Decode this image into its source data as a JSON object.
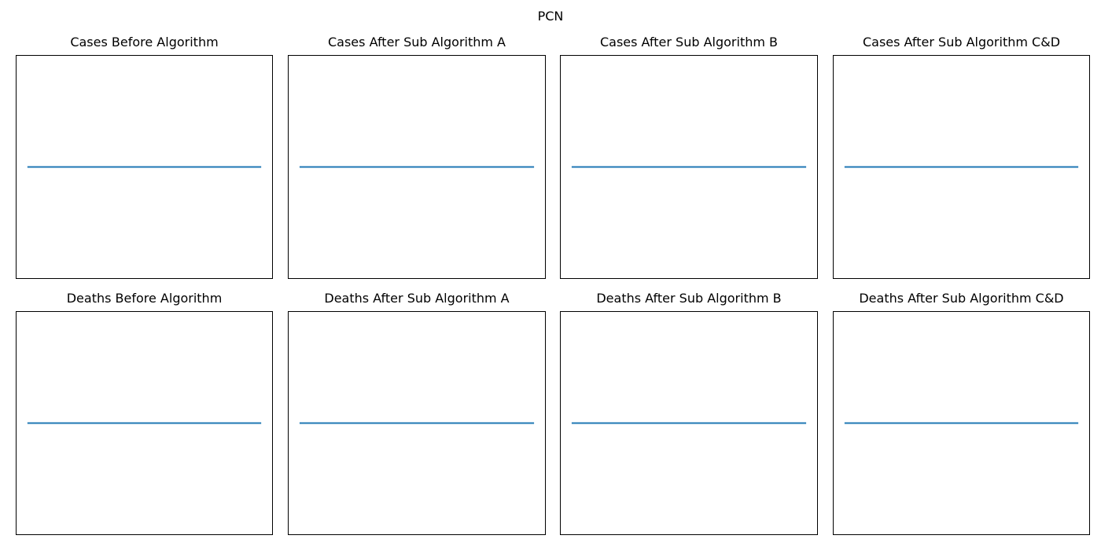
{
  "figure": {
    "suptitle": "PCN",
    "line_color": "#1f77b4"
  },
  "chart_data": [
    {
      "type": "line",
      "title": "Cases Before Algorithm",
      "xlabel": "",
      "ylabel": "",
      "series": [
        {
          "x": [
            0,
            1
          ],
          "values": [
            0,
            0
          ]
        }
      ],
      "xlim": [
        -0.05,
        1.05
      ],
      "ylim": [
        -0.055,
        0.055
      ],
      "ticks_visible": false,
      "grid": false
    },
    {
      "type": "line",
      "title": "Cases After Sub Algorithm A",
      "xlabel": "",
      "ylabel": "",
      "series": [
        {
          "x": [
            0,
            1
          ],
          "values": [
            0,
            0
          ]
        }
      ],
      "xlim": [
        -0.05,
        1.05
      ],
      "ylim": [
        -0.055,
        0.055
      ],
      "ticks_visible": false,
      "grid": false
    },
    {
      "type": "line",
      "title": "Cases After Sub Algorithm B",
      "xlabel": "",
      "ylabel": "",
      "series": [
        {
          "x": [
            0,
            1
          ],
          "values": [
            0,
            0
          ]
        }
      ],
      "xlim": [
        -0.05,
        1.05
      ],
      "ylim": [
        -0.055,
        0.055
      ],
      "ticks_visible": false,
      "grid": false
    },
    {
      "type": "line",
      "title": "Cases After Sub Algorithm C&D",
      "xlabel": "",
      "ylabel": "",
      "series": [
        {
          "x": [
            0,
            1
          ],
          "values": [
            0,
            0
          ]
        }
      ],
      "xlim": [
        -0.05,
        1.05
      ],
      "ylim": [
        -0.055,
        0.055
      ],
      "ticks_visible": false,
      "grid": false
    },
    {
      "type": "line",
      "title": "Deaths Before Algorithm",
      "xlabel": "",
      "ylabel": "",
      "series": [
        {
          "x": [
            0,
            1
          ],
          "values": [
            0,
            0
          ]
        }
      ],
      "xlim": [
        -0.05,
        1.05
      ],
      "ylim": [
        -0.055,
        0.055
      ],
      "ticks_visible": false,
      "grid": false
    },
    {
      "type": "line",
      "title": "Deaths After Sub Algorithm A",
      "xlabel": "",
      "ylabel": "",
      "series": [
        {
          "x": [
            0,
            1
          ],
          "values": [
            0,
            0
          ]
        }
      ],
      "xlim": [
        -0.05,
        1.05
      ],
      "ylim": [
        -0.055,
        0.055
      ],
      "ticks_visible": false,
      "grid": false
    },
    {
      "type": "line",
      "title": "Deaths After Sub Algorithm B",
      "xlabel": "",
      "ylabel": "",
      "series": [
        {
          "x": [
            0,
            1
          ],
          "values": [
            0,
            0
          ]
        }
      ],
      "xlim": [
        -0.05,
        1.05
      ],
      "ylim": [
        -0.055,
        0.055
      ],
      "ticks_visible": false,
      "grid": false
    },
    {
      "type": "line",
      "title": "Deaths After Sub Algorithm C&D",
      "xlabel": "",
      "ylabel": "",
      "series": [
        {
          "x": [
            0,
            1
          ],
          "values": [
            0,
            0
          ]
        }
      ],
      "xlim": [
        -0.05,
        1.05
      ],
      "ylim": [
        -0.055,
        0.055
      ],
      "ticks_visible": false,
      "grid": false
    }
  ]
}
